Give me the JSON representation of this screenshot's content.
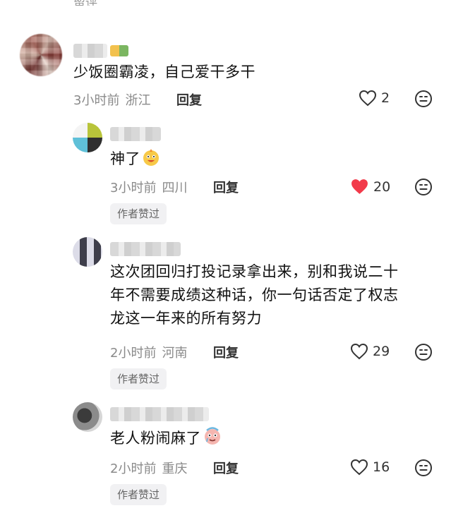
{
  "top_remnant": {
    "text": "留评"
  },
  "comments": [
    {
      "id": "c1",
      "content": "少饭圈霸凌，自己爱干多干",
      "time": "3小时前",
      "location": "浙江",
      "reply_label": "回复",
      "likes": "2",
      "liked": false
    },
    {
      "id": "c2",
      "content": "神了",
      "emoji": "excited-face-emoji",
      "time": "3小时前",
      "location": "四川",
      "reply_label": "回复",
      "likes": "20",
      "liked": true,
      "author_liked": "作者赞过"
    },
    {
      "id": "c3",
      "content_lines": [
        "这次团回归打投记录拿出来，别和我说二十",
        "年不需要成绩这种话，你一句话否定了权志",
        "龙这一年来的所有努力"
      ],
      "time": "2小时前",
      "location": "河南",
      "reply_label": "回复",
      "likes": "29",
      "liked": false,
      "author_liked": "作者赞过"
    },
    {
      "id": "c4",
      "content": "老人粉闹麻了",
      "emoji": "crying-face-emoji",
      "time": "2小时前",
      "location": "重庆",
      "reply_label": "回复",
      "likes": "16",
      "liked": false,
      "author_liked": "作者赞过"
    }
  ],
  "colors": {
    "liked_heart": "#f23a4a",
    "meta_gray": "#8a8a8a",
    "badge_bg": "#f1f1f3"
  }
}
